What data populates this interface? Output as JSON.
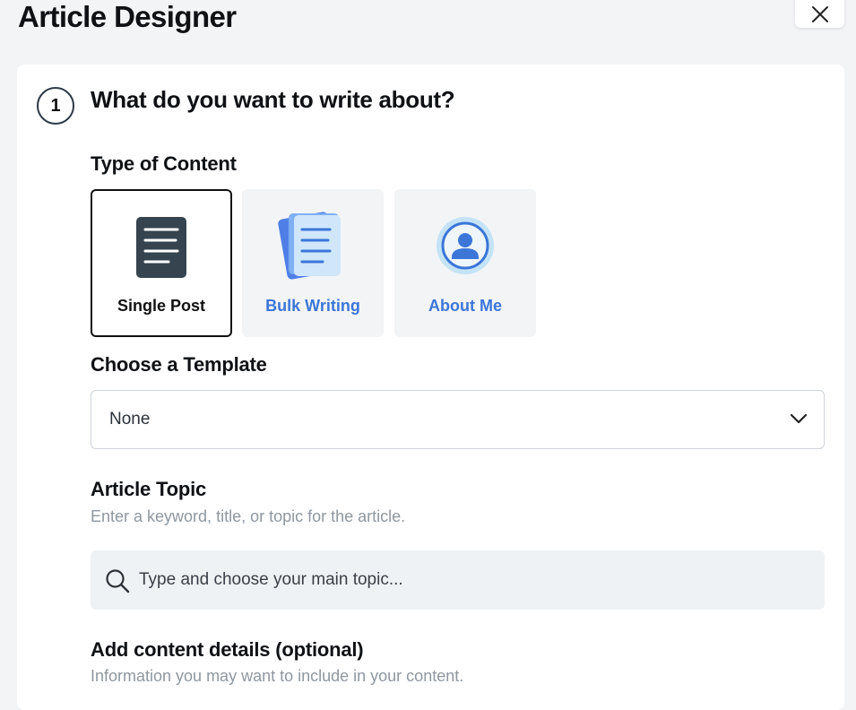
{
  "header": {
    "title": "Article Designer",
    "close_icon": "close-icon"
  },
  "step": {
    "number": "1",
    "title": "What do you want to write about?"
  },
  "content_type": {
    "label": "Type of Content",
    "options": [
      {
        "label": "Single Post",
        "icon": "document-icon",
        "selected": true
      },
      {
        "label": "Bulk Writing",
        "icon": "documents-stack-icon",
        "selected": false
      },
      {
        "label": "About Me",
        "icon": "user-circle-icon",
        "selected": false
      }
    ]
  },
  "template": {
    "label": "Choose a Template",
    "selected_value": "None"
  },
  "topic": {
    "label": "Article Topic",
    "description": "Enter a keyword, title, or topic for the article.",
    "placeholder": "Type and choose your main topic...",
    "value": ""
  },
  "details": {
    "label": "Add content details (optional)",
    "description": "Information you may want to include in your content."
  },
  "colors": {
    "accent": "#3b76d8",
    "tile_bg": "#f2f4f6",
    "dark_icon": "#36444f"
  }
}
